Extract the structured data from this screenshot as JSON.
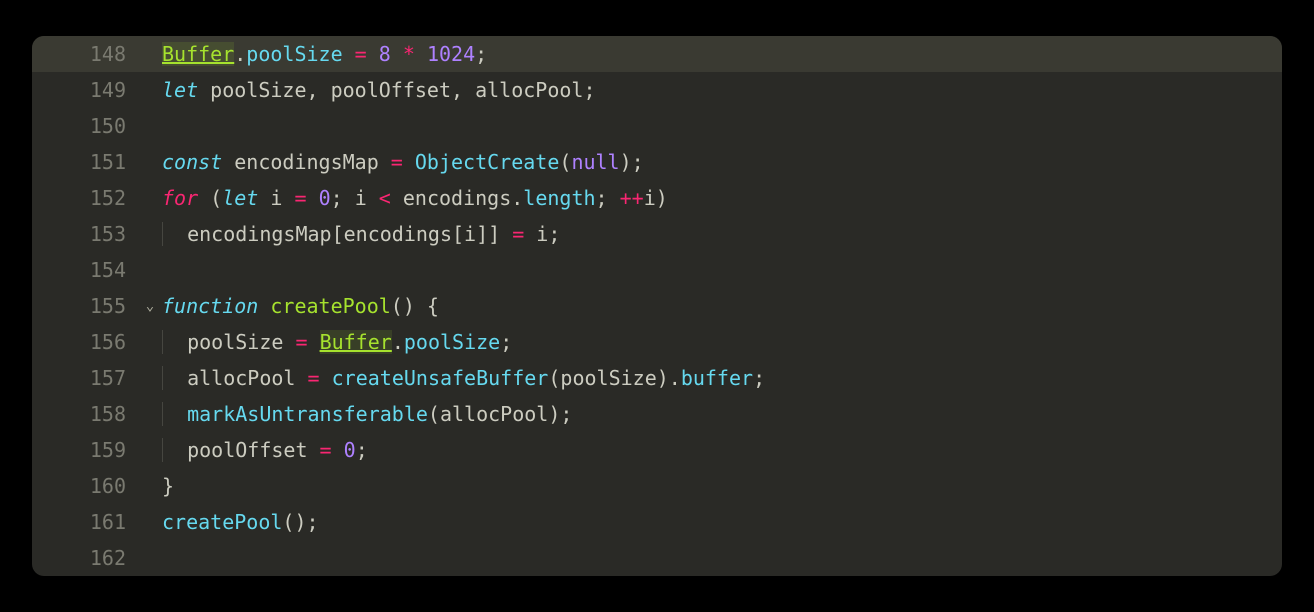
{
  "lines": [
    {
      "num": "148",
      "highlighted": true,
      "fold": "",
      "tokens": [
        {
          "t": "Buffer",
          "c": "tok-class-hl"
        },
        {
          "t": ".",
          "c": "tok-punct"
        },
        {
          "t": "poolSize",
          "c": "tok-prop"
        },
        {
          "t": " ",
          "c": ""
        },
        {
          "t": "=",
          "c": "tok-op"
        },
        {
          "t": " ",
          "c": ""
        },
        {
          "t": "8",
          "c": "tok-num"
        },
        {
          "t": " ",
          "c": ""
        },
        {
          "t": "*",
          "c": "tok-op"
        },
        {
          "t": " ",
          "c": ""
        },
        {
          "t": "1024",
          "c": "tok-num"
        },
        {
          "t": ";",
          "c": "tok-punct"
        }
      ]
    },
    {
      "num": "149",
      "fold": "",
      "tokens": [
        {
          "t": "let",
          "c": "tok-keyword2"
        },
        {
          "t": " poolSize, poolOffset, allocPool;",
          "c": "tok-var"
        }
      ]
    },
    {
      "num": "150",
      "fold": "",
      "tokens": []
    },
    {
      "num": "151",
      "fold": "",
      "tokens": [
        {
          "t": "const",
          "c": "tok-keyword2"
        },
        {
          "t": " encodingsMap ",
          "c": "tok-var"
        },
        {
          "t": "=",
          "c": "tok-op"
        },
        {
          "t": " ",
          "c": ""
        },
        {
          "t": "ObjectCreate",
          "c": "tok-call"
        },
        {
          "t": "(",
          "c": "tok-punct"
        },
        {
          "t": "null",
          "c": "tok-const"
        },
        {
          "t": ");",
          "c": "tok-punct"
        }
      ]
    },
    {
      "num": "152",
      "fold": "",
      "tokens": [
        {
          "t": "for",
          "c": "tok-keyword"
        },
        {
          "t": " (",
          "c": "tok-punct"
        },
        {
          "t": "let",
          "c": "tok-keyword2"
        },
        {
          "t": " i ",
          "c": "tok-var"
        },
        {
          "t": "=",
          "c": "tok-op"
        },
        {
          "t": " ",
          "c": ""
        },
        {
          "t": "0",
          "c": "tok-num"
        },
        {
          "t": "; i ",
          "c": "tok-var"
        },
        {
          "t": "<",
          "c": "tok-op"
        },
        {
          "t": " encodings.",
          "c": "tok-var"
        },
        {
          "t": "length",
          "c": "tok-prop"
        },
        {
          "t": "; ",
          "c": "tok-punct"
        },
        {
          "t": "++",
          "c": "tok-op"
        },
        {
          "t": "i)",
          "c": "tok-var"
        }
      ]
    },
    {
      "num": "153",
      "fold": "",
      "indent": 1,
      "tokens": [
        {
          "t": "encodingsMap[encodings[i]] ",
          "c": "tok-var"
        },
        {
          "t": "=",
          "c": "tok-op"
        },
        {
          "t": " i;",
          "c": "tok-var"
        }
      ]
    },
    {
      "num": "154",
      "fold": "",
      "tokens": []
    },
    {
      "num": "155",
      "fold": "chevron",
      "tokens": [
        {
          "t": "function",
          "c": "tok-keyword2"
        },
        {
          "t": " ",
          "c": ""
        },
        {
          "t": "createPool",
          "c": "tok-func"
        },
        {
          "t": "() {",
          "c": "tok-punct"
        }
      ]
    },
    {
      "num": "156",
      "fold": "",
      "indent": 1,
      "tokens": [
        {
          "t": "poolSize ",
          "c": "tok-var"
        },
        {
          "t": "=",
          "c": "tok-op"
        },
        {
          "t": " ",
          "c": ""
        },
        {
          "t": "Buffer",
          "c": "tok-class-hl"
        },
        {
          "t": ".",
          "c": "tok-punct"
        },
        {
          "t": "poolSize",
          "c": "tok-prop"
        },
        {
          "t": ";",
          "c": "tok-punct"
        }
      ]
    },
    {
      "num": "157",
      "fold": "",
      "indent": 1,
      "tokens": [
        {
          "t": "allocPool ",
          "c": "tok-var"
        },
        {
          "t": "=",
          "c": "tok-op"
        },
        {
          "t": " ",
          "c": ""
        },
        {
          "t": "createUnsafeBuffer",
          "c": "tok-call"
        },
        {
          "t": "(poolSize).",
          "c": "tok-var"
        },
        {
          "t": "buffer",
          "c": "tok-prop"
        },
        {
          "t": ";",
          "c": "tok-punct"
        }
      ]
    },
    {
      "num": "158",
      "fold": "",
      "indent": 1,
      "tokens": [
        {
          "t": "markAsUntransferable",
          "c": "tok-call"
        },
        {
          "t": "(allocPool);",
          "c": "tok-var"
        }
      ]
    },
    {
      "num": "159",
      "fold": "",
      "indent": 1,
      "tokens": [
        {
          "t": "poolOffset ",
          "c": "tok-var"
        },
        {
          "t": "=",
          "c": "tok-op"
        },
        {
          "t": " ",
          "c": ""
        },
        {
          "t": "0",
          "c": "tok-num"
        },
        {
          "t": ";",
          "c": "tok-punct"
        }
      ]
    },
    {
      "num": "160",
      "fold": "",
      "tokens": [
        {
          "t": "}",
          "c": "tok-punct"
        }
      ]
    },
    {
      "num": "161",
      "fold": "",
      "tokens": [
        {
          "t": "createPool",
          "c": "tok-call"
        },
        {
          "t": "();",
          "c": "tok-punct"
        }
      ]
    },
    {
      "num": "162",
      "fold": "",
      "tokens": []
    }
  ]
}
